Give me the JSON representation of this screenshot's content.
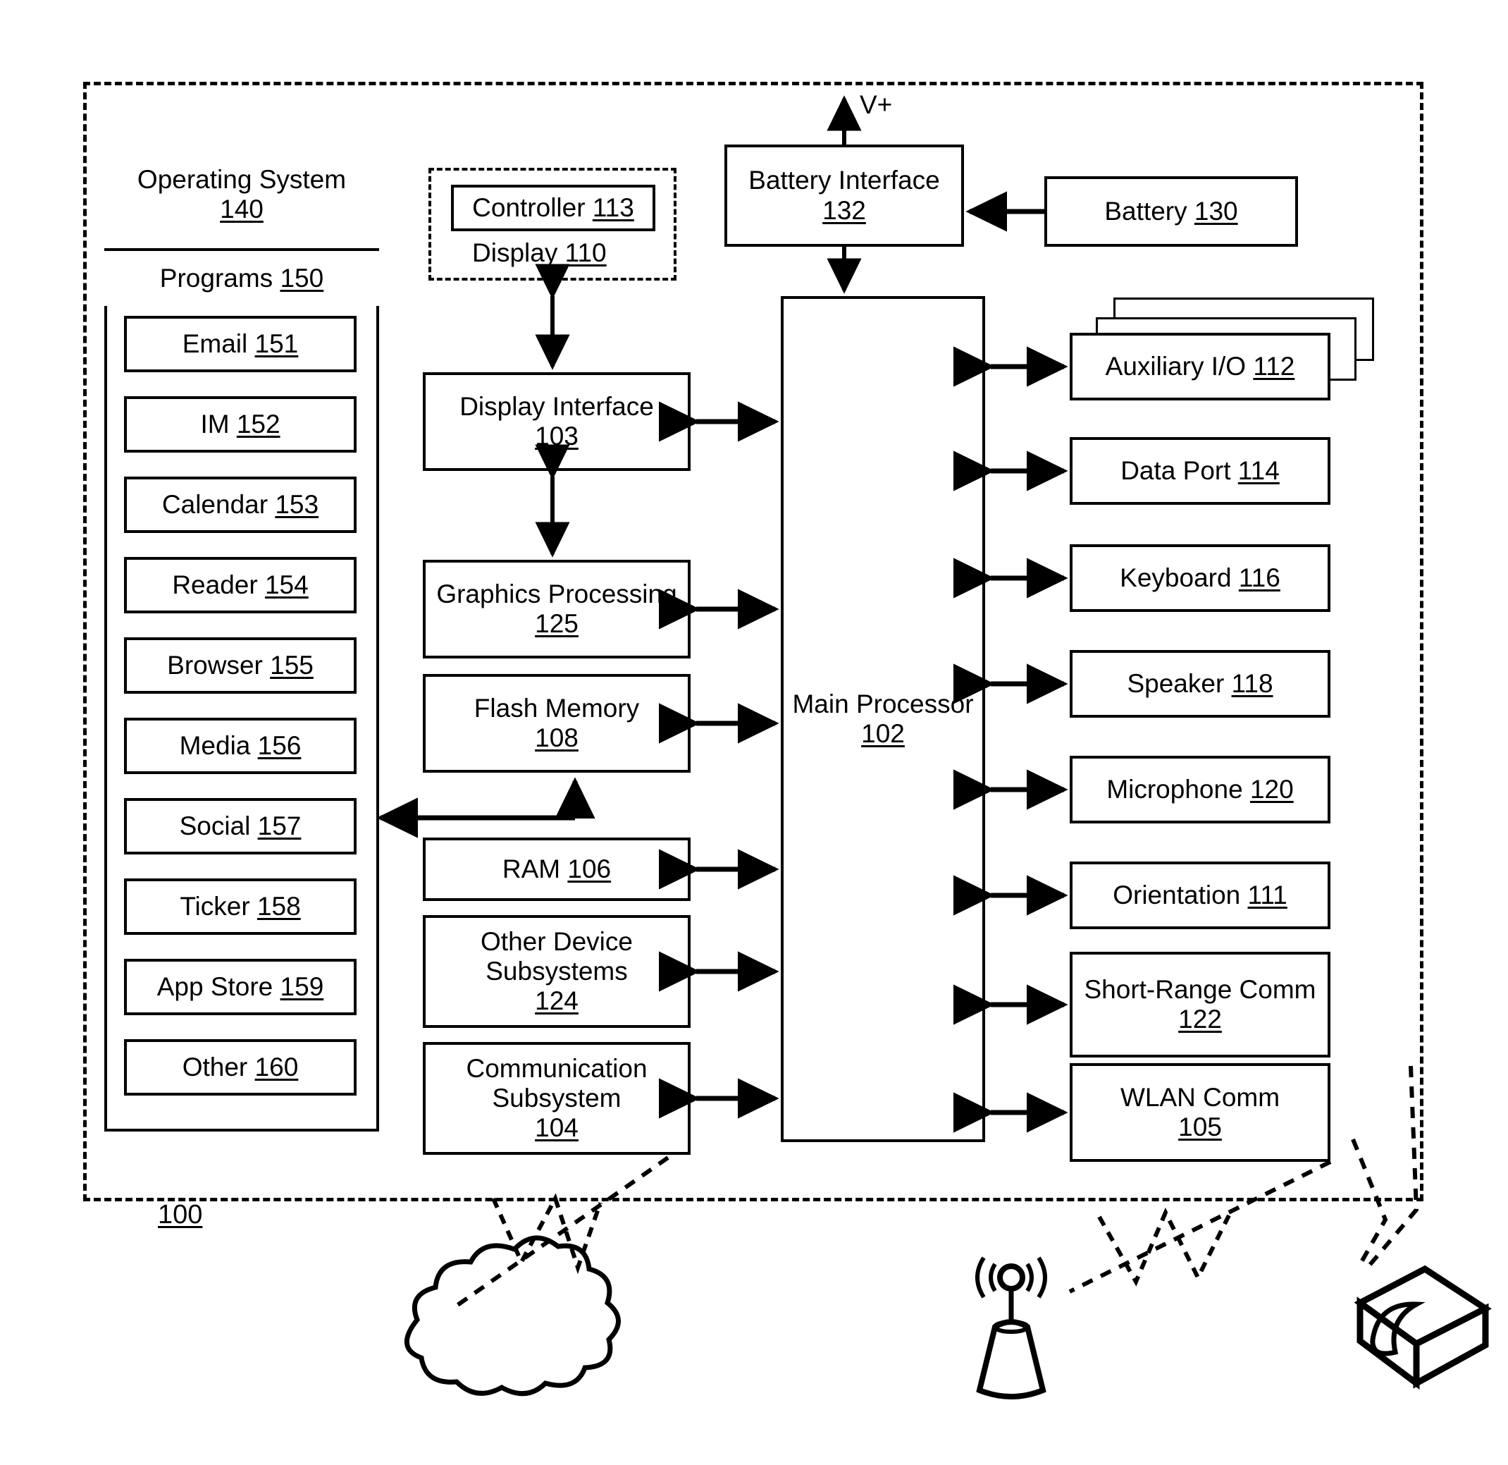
{
  "figure": {
    "device_ref": "100",
    "power_label": "V+"
  },
  "os_stack": {
    "operating_system": {
      "name": "Operating System",
      "ref": "140"
    },
    "programs": {
      "name": "Programs",
      "ref": "150"
    },
    "items": [
      {
        "name": "Email",
        "ref": "151"
      },
      {
        "name": "IM",
        "ref": "152"
      },
      {
        "name": "Calendar",
        "ref": "153"
      },
      {
        "name": "Reader",
        "ref": "154"
      },
      {
        "name": "Browser",
        "ref": "155"
      },
      {
        "name": "Media",
        "ref": "156"
      },
      {
        "name": "Social",
        "ref": "157"
      },
      {
        "name": "Ticker",
        "ref": "158"
      },
      {
        "name": "App Store",
        "ref": "159"
      },
      {
        "name": "Other",
        "ref": "160"
      }
    ]
  },
  "display_group": {
    "controller": {
      "name": "Controller",
      "ref": "113"
    },
    "display": {
      "name": "Display",
      "ref": "110"
    }
  },
  "center_column": [
    {
      "name": "Display Interface",
      "ref": "103"
    },
    {
      "name": "Graphics Processing",
      "ref": "125"
    },
    {
      "name": "Flash Memory",
      "ref": "108"
    },
    {
      "name": "RAM",
      "ref": "106"
    },
    {
      "name": "Other Device Subsystems",
      "ref": "124"
    },
    {
      "name": "Communication Subsystem",
      "ref": "104"
    }
  ],
  "processor": {
    "name": "Main Processor",
    "ref": "102"
  },
  "power": {
    "battery_interface": {
      "name": "Battery Interface",
      "ref": "132"
    },
    "battery": {
      "name": "Battery",
      "ref": "130"
    }
  },
  "peripherals": [
    {
      "name": "Auxiliary I/O",
      "ref": "112"
    },
    {
      "name": "Data Port",
      "ref": "114"
    },
    {
      "name": "Keyboard",
      "ref": "116"
    },
    {
      "name": "Speaker",
      "ref": "118"
    },
    {
      "name": "Microphone",
      "ref": "120"
    },
    {
      "name": "Orientation",
      "ref": "111"
    },
    {
      "name": "Short-Range Comm",
      "ref": "122"
    },
    {
      "name": "WLAN Comm",
      "ref": "105"
    }
  ],
  "external_art": {
    "network_cloud": "cloud",
    "cell_tower": "cell-tower",
    "wireless_access_point": "access-point"
  },
  "colors": {
    "line": "#000000",
    "background": "#ffffff"
  }
}
